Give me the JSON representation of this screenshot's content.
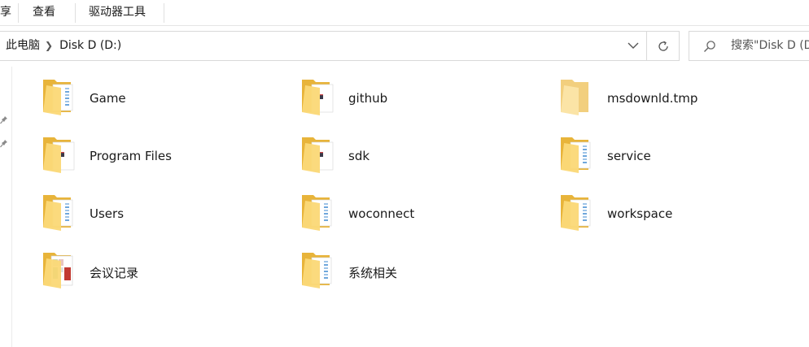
{
  "ribbon": {
    "tabs": [
      {
        "label": "享"
      },
      {
        "label": "查看"
      },
      {
        "label": "驱动器工具"
      }
    ]
  },
  "address": {
    "crumbs": [
      "此电脑",
      "Disk D (D:)"
    ]
  },
  "search": {
    "placeholder": "搜索\"Disk D (D:)\""
  },
  "items": [
    {
      "name": "Game",
      "icon": "folder-docs-icon"
    },
    {
      "name": "github",
      "icon": "folder-file-icon"
    },
    {
      "name": "msdownld.tmp",
      "icon": "folder-empty-icon"
    },
    {
      "name": "Program Files",
      "icon": "folder-file-icon"
    },
    {
      "name": "sdk",
      "icon": "folder-file-icon"
    },
    {
      "name": "service",
      "icon": "folder-docs-icon"
    },
    {
      "name": "Users",
      "icon": "folder-docs-icon"
    },
    {
      "name": "woconnect",
      "icon": "folder-docs-icon"
    },
    {
      "name": "workspace",
      "icon": "folder-docs-icon"
    },
    {
      "name": "会议记录",
      "icon": "folder-images-icon"
    },
    {
      "name": "系统相关",
      "icon": "folder-docs-icon"
    }
  ],
  "colors": {
    "folder_back": "#e8b43a",
    "folder_front": "#fbd978",
    "folder_empty": "#fbe4a6",
    "accent_blue": "#3c86d4"
  }
}
